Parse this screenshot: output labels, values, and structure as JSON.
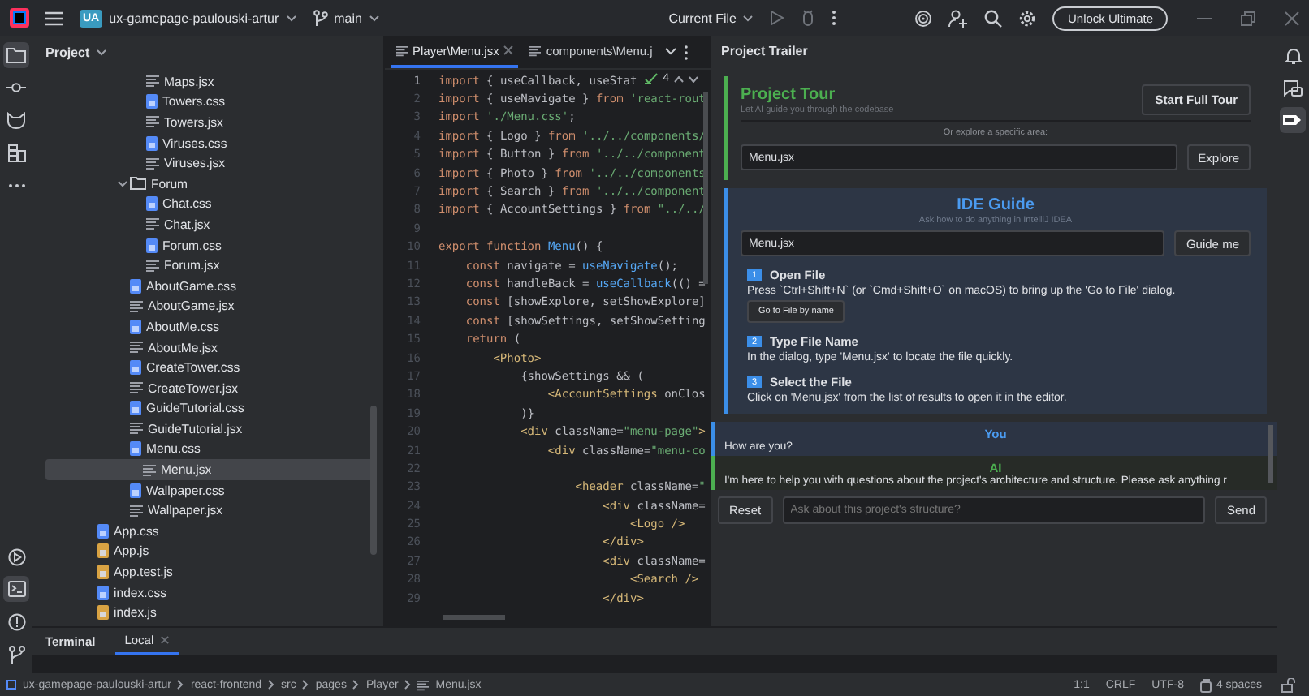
{
  "toolbar": {
    "project_badge": "UA",
    "project_name": "ux-gamepage-paulouski-artur",
    "branch": "main",
    "run_config": "Current File",
    "upgrade_button": "Unlock Ultimate"
  },
  "left_tools": [
    {
      "kind": "folder",
      "selected": true
    },
    {
      "kind": "commit",
      "selected": false
    },
    {
      "kind": "cat",
      "selected": false
    },
    {
      "kind": "structure",
      "selected": false
    },
    {
      "kind": "more",
      "selected": false
    }
  ],
  "left_tools_bottom": [
    {
      "kind": "run",
      "selected": false
    },
    {
      "kind": "terminal",
      "selected": true
    },
    {
      "kind": "problems",
      "selected": false
    },
    {
      "kind": "git",
      "selected": false
    }
  ],
  "project_panel": {
    "title": "Project",
    "tree": [
      {
        "children": [
          {
            "children": [
              {
                "children": [
                  {
                    "label": "Maps.jsx",
                    "kind": "jsx",
                    "selected": false
                  },
                  {
                    "label": "Towers.css",
                    "kind": "css",
                    "selected": false
                  },
                  {
                    "label": "Towers.jsx",
                    "kind": "jsx",
                    "selected": false
                  },
                  {
                    "label": "Viruses.css",
                    "kind": "css",
                    "selected": false
                  },
                  {
                    "label": "Viruses.jsx",
                    "kind": "jsx",
                    "selected": false
                  }
                ]
              },
              {
                "label": "Forum",
                "kind": "folder",
                "expanded": true,
                "selected": false,
                "children": [
                  {
                    "label": "Chat.css",
                    "kind": "css",
                    "selected": false
                  },
                  {
                    "label": "Chat.jsx",
                    "kind": "jsx",
                    "selected": false
                  },
                  {
                    "label": "Forum.css",
                    "kind": "css",
                    "selected": false
                  },
                  {
                    "label": "Forum.jsx",
                    "kind": "jsx",
                    "selected": false
                  }
                ]
              },
              {
                "label": "AboutGame.css",
                "kind": "css",
                "selected": false
              },
              {
                "label": "AboutGame.jsx",
                "kind": "jsx",
                "selected": false
              },
              {
                "label": "AboutMe.css",
                "kind": "css",
                "selected": false
              },
              {
                "label": "AboutMe.jsx",
                "kind": "jsx",
                "selected": false
              },
              {
                "label": "CreateTower.css",
                "kind": "css",
                "selected": false
              },
              {
                "label": "CreateTower.jsx",
                "kind": "jsx",
                "selected": false
              },
              {
                "label": "GuideTutorial.css",
                "kind": "css",
                "selected": false
              },
              {
                "label": "GuideTutorial.jsx",
                "kind": "jsx",
                "selected": false
              },
              {
                "label": "Menu.css",
                "kind": "css",
                "selected": false
              },
              {
                "label": "Menu.jsx",
                "kind": "jsx",
                "selected": true
              },
              {
                "label": "Wallpaper.css",
                "kind": "css",
                "selected": false
              },
              {
                "label": "Wallpaper.jsx",
                "kind": "jsx",
                "selected": false
              }
            ]
          }
        ]
      },
      {
        "label": "App.css",
        "kind": "css",
        "selected": false
      },
      {
        "label": "App.js",
        "kind": "js",
        "selected": false
      },
      {
        "label": "App.test.js",
        "kind": "js",
        "selected": false
      },
      {
        "label": "index.css",
        "kind": "css",
        "selected": false
      },
      {
        "label": "index.js",
        "kind": "js",
        "selected": false
      }
    ]
  },
  "editor": {
    "tabs": [
      {
        "label": "Player\\Menu.jsx",
        "selected": true,
        "closable": true
      },
      {
        "label": "components\\Menu.j",
        "selected": false,
        "closable": false
      }
    ],
    "inspection_count": "4",
    "lines": [
      {
        "num": "1",
        "tokens": [
          {
            "text": "import",
            "kind": "keyword"
          },
          {
            "text": " { useCallback, useStat",
            "kind": "plain"
          }
        ]
      },
      {
        "num": "2",
        "tokens": [
          {
            "text": "import",
            "kind": "keyword"
          },
          {
            "text": " { useNavigate } ",
            "kind": "plain"
          },
          {
            "text": "from",
            "kind": "keyword"
          },
          {
            "text": " 'react-rout",
            "kind": "string"
          }
        ]
      },
      {
        "num": "3",
        "tokens": [
          {
            "text": "import",
            "kind": "keyword"
          },
          {
            "text": " './Menu.css'",
            "kind": "string"
          },
          {
            "text": ";",
            "kind": "plain"
          }
        ]
      },
      {
        "num": "4",
        "tokens": [
          {
            "text": "import",
            "kind": "keyword"
          },
          {
            "text": " { Logo } ",
            "kind": "plain"
          },
          {
            "text": "from",
            "kind": "keyword"
          },
          {
            "text": " '../../components/",
            "kind": "string"
          }
        ]
      },
      {
        "num": "5",
        "tokens": [
          {
            "text": "import",
            "kind": "keyword"
          },
          {
            "text": " { Button } ",
            "kind": "plain"
          },
          {
            "text": "from",
            "kind": "keyword"
          },
          {
            "text": " '../../component",
            "kind": "string"
          }
        ]
      },
      {
        "num": "6",
        "tokens": [
          {
            "text": "import",
            "kind": "keyword"
          },
          {
            "text": " { Photo } ",
            "kind": "plain"
          },
          {
            "text": "from",
            "kind": "keyword"
          },
          {
            "text": " '../../components",
            "kind": "string"
          }
        ]
      },
      {
        "num": "7",
        "tokens": [
          {
            "text": "import",
            "kind": "keyword"
          },
          {
            "text": " { Search } ",
            "kind": "plain"
          },
          {
            "text": "from",
            "kind": "keyword"
          },
          {
            "text": " '../../component",
            "kind": "string"
          }
        ]
      },
      {
        "num": "8",
        "tokens": [
          {
            "text": "import",
            "kind": "keyword"
          },
          {
            "text": " { AccountSettings } ",
            "kind": "plain"
          },
          {
            "text": "from",
            "kind": "keyword"
          },
          {
            "text": " \"../../",
            "kind": "string"
          }
        ]
      },
      {
        "num": "9"
      },
      {
        "num": "10",
        "tokens": [
          {
            "text": "export function ",
            "kind": "keyword"
          },
          {
            "text": "Menu",
            "kind": "function"
          },
          {
            "text": "() {",
            "kind": "plain"
          }
        ]
      },
      {
        "num": "11",
        "tokens": [
          {
            "text": "    const",
            "kind": "keyword"
          },
          {
            "text": " navigate = ",
            "kind": "plain"
          },
          {
            "text": "useNavigate",
            "kind": "function"
          },
          {
            "text": "();",
            "kind": "plain"
          }
        ]
      },
      {
        "num": "12",
        "tokens": [
          {
            "text": "    const",
            "kind": "keyword"
          },
          {
            "text": " handleBack = ",
            "kind": "plain"
          },
          {
            "text": "useCallback",
            "kind": "function"
          },
          {
            "text": "(() =",
            "kind": "plain"
          }
        ]
      },
      {
        "num": "13",
        "tokens": [
          {
            "text": "    const",
            "kind": "keyword"
          },
          {
            "text": " [showExplore, setShowExplore]",
            "kind": "plain"
          }
        ]
      },
      {
        "num": "14",
        "tokens": [
          {
            "text": "    const",
            "kind": "keyword"
          },
          {
            "text": " [showSettings, setShowSetting",
            "kind": "plain"
          }
        ]
      },
      {
        "num": "15",
        "tokens": [
          {
            "text": "    return",
            "kind": "keyword"
          },
          {
            "text": " (",
            "kind": "plain"
          }
        ]
      },
      {
        "num": "16",
        "tokens": [
          {
            "text": "        <Photo>",
            "kind": "tag"
          }
        ]
      },
      {
        "num": "17",
        "tokens": [
          {
            "text": "            {showSettings && (",
            "kind": "plain"
          }
        ]
      },
      {
        "num": "18",
        "tokens": [
          {
            "text": "                <AccountSettings",
            "kind": "tag"
          },
          {
            "text": " onClos",
            "kind": "plain"
          }
        ]
      },
      {
        "num": "19",
        "tokens": [
          {
            "text": "            )}",
            "kind": "plain"
          }
        ]
      },
      {
        "num": "20",
        "tokens": [
          {
            "text": "            <div",
            "kind": "tag"
          },
          {
            "text": " className=",
            "kind": "plain"
          },
          {
            "text": "\"menu-page\"",
            "kind": "string"
          },
          {
            "text": ">",
            "kind": "tag"
          }
        ]
      },
      {
        "num": "21",
        "tokens": [
          {
            "text": "                <div",
            "kind": "tag"
          },
          {
            "text": " className=",
            "kind": "plain"
          },
          {
            "text": "\"menu-co",
            "kind": "string"
          }
        ]
      },
      {
        "num": "22"
      },
      {
        "num": "23",
        "tokens": [
          {
            "text": "                    <header",
            "kind": "tag"
          },
          {
            "text": " className=",
            "kind": "plain"
          },
          {
            "text": "\"",
            "kind": "string"
          }
        ]
      },
      {
        "num": "24",
        "tokens": [
          {
            "text": "                        <div",
            "kind": "tag"
          },
          {
            "text": " className=",
            "kind": "plain"
          }
        ]
      },
      {
        "num": "25",
        "tokens": [
          {
            "text": "                            <Logo />",
            "kind": "tag"
          }
        ]
      },
      {
        "num": "26",
        "tokens": [
          {
            "text": "                        </div>",
            "kind": "tag"
          }
        ]
      },
      {
        "num": "27",
        "tokens": [
          {
            "text": "                        <div",
            "kind": "tag"
          },
          {
            "text": " className=",
            "kind": "plain"
          }
        ]
      },
      {
        "num": "28",
        "tokens": [
          {
            "text": "                            <Search />",
            "kind": "tag"
          }
        ]
      },
      {
        "num": "29",
        "tokens": [
          {
            "text": "                        </div>",
            "kind": "tag"
          }
        ]
      }
    ]
  },
  "assistant_panel": {
    "title": "Project Trailer",
    "tour": {
      "title": "Project Tour",
      "subtitle": "Let AI guide you through the codebase",
      "start_button": "Start Full Tour",
      "explore_hint": "Or explore a specific area:",
      "explore_value": "Menu.jsx",
      "explore_button": "Explore"
    },
    "guide": {
      "title": "IDE Guide",
      "subtitle": "Ask how to do anything in IntelliJ IDEA",
      "query_value": "Menu.jsx",
      "guide_button": "Guide me",
      "steps": [
        {
          "number": "1",
          "title": "Open File",
          "text": "Press `Ctrl+Shift+N` (or `Cmd+Shift+O` on macOS) to bring up the 'Go to File' dialog.",
          "action": "Go to File by name"
        },
        {
          "number": "2",
          "title": "Type File Name",
          "text": "In the dialog, type 'Menu.jsx' to locate the file quickly."
        },
        {
          "number": "3",
          "title": "Select the File",
          "text": "Click on 'Menu.jsx' from the list of results to open it in the editor."
        }
      ]
    },
    "messages": [
      {
        "kind": "user",
        "author": "You",
        "text": "How are you?"
      },
      {
        "kind": "ai",
        "author": "AI",
        "text": "I'm here to help you with questions about the project's architecture and structure. Please ask anything r"
      }
    ],
    "reset_button": "Reset",
    "ask_placeholder": "Ask about this project's structure?",
    "send_button": "Send"
  },
  "right_tools": [
    {
      "kind": "bell",
      "selected": false
    },
    {
      "kind": "chat",
      "selected": false
    },
    {
      "kind": "plugin",
      "selected": true
    }
  ],
  "terminal": {
    "title": "Terminal",
    "tabs": [
      {
        "label": "Local",
        "selected": true
      }
    ]
  },
  "status_bar": {
    "breadcrumbs": [
      "ux-gamepage-paulouski-artur",
      "react-frontend",
      "src",
      "pages",
      "Player",
      "Menu.jsx"
    ],
    "position": "1:1",
    "line_endings": "CRLF",
    "encoding": "UTF-8",
    "indent": "4 spaces"
  }
}
